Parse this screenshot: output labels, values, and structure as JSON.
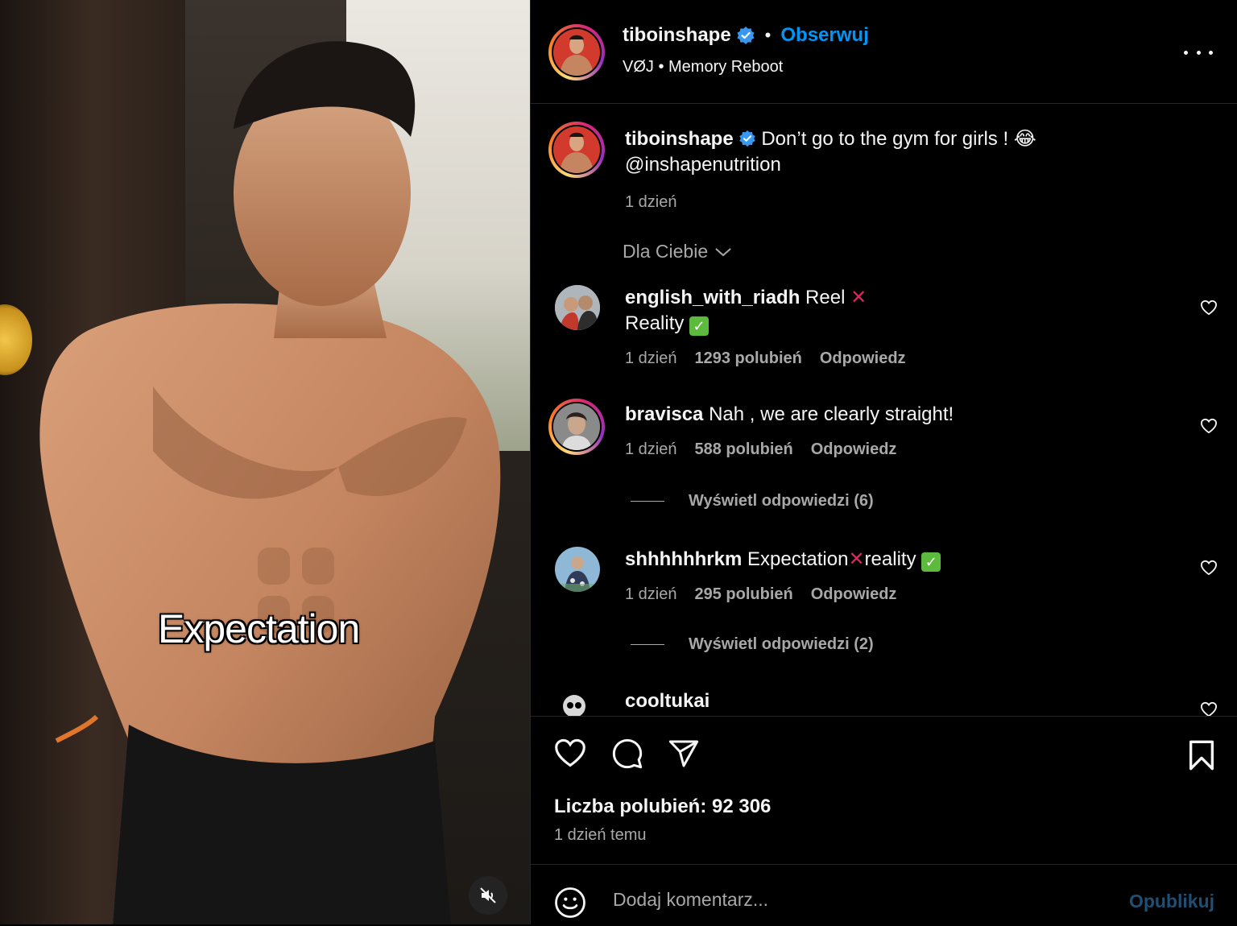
{
  "video": {
    "caption_overlay": "Expectation",
    "mute_icon": "speaker-muted-icon"
  },
  "header": {
    "username": "tiboinshape",
    "follow_label": "Obserwuj",
    "separator": "•",
    "audio": "VØJ • Memory Reboot",
    "more_icon": "more-horizontal-icon"
  },
  "post_caption": {
    "username": "tiboinshape",
    "text": "Don’t go to the gym for girls ! 😂",
    "mention": "@inshapenutrition",
    "time": "1 dzień"
  },
  "sort": {
    "label": "Dla Ciebie"
  },
  "comments": [
    {
      "username": "english_with_riadh",
      "text_a": "Reel",
      "mark_a": "✕",
      "text_b": "Reality",
      "mark_b": "✓",
      "time": "1 dzień",
      "likes": "1293 polubień",
      "reply": "Odpowiedz"
    },
    {
      "username": "bravisca",
      "text": "Nah , we are clearly straight!",
      "time": "1 dzień",
      "likes": "588 polubień",
      "reply": "Odpowiedz",
      "view_replies": "Wyświetl odpowiedzi (6)"
    },
    {
      "username": "shhhhhhrkm",
      "text_a": "Expectation",
      "mark_a": "✕",
      "text_b": "reality",
      "mark_b": "✓",
      "time": "1 dzień",
      "likes": "295 polubień",
      "reply": "Odpowiedz",
      "view_replies": "Wyświetl odpowiedzi (2)"
    },
    {
      "username": "cooltukai"
    }
  ],
  "footer": {
    "likes": "Liczba polubień: 92 306",
    "time_ago": "1 dzień temu",
    "comment_placeholder": "Dodaj komentarz...",
    "post_label": "Opublikuj"
  },
  "colors": {
    "accent": "#0095f6",
    "background": "#000000",
    "secondary_text": "#a8a8a8",
    "verified": "#3897f0"
  }
}
